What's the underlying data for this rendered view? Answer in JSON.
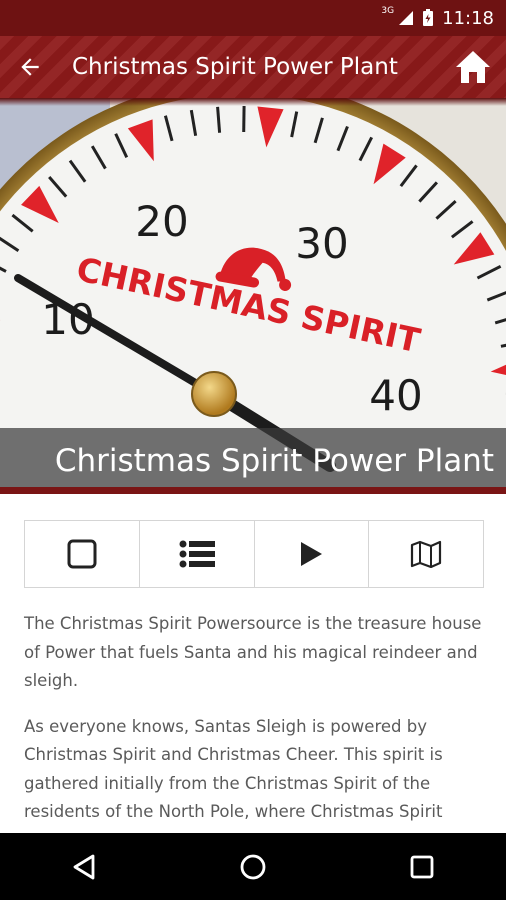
{
  "status_bar": {
    "network": "3G",
    "time": "11:18"
  },
  "app_bar": {
    "title": "Christmas Spirit Power Plant",
    "back_icon": "arrow-left-icon",
    "home_icon": "home-icon"
  },
  "hero": {
    "caption": "Christmas Spirit Power Plant",
    "gauge": {
      "numbers": [
        "10",
        "20",
        "30",
        "40"
      ],
      "label": "CHRISTMAS SPIRIT",
      "needle_value": 8
    }
  },
  "toolbar": {
    "buttons": [
      {
        "icon": "checkbox-icon"
      },
      {
        "icon": "list-icon"
      },
      {
        "icon": "play-icon"
      },
      {
        "icon": "map-icon"
      }
    ]
  },
  "content": {
    "paragraphs": [
      "The Christmas Spirit Powersource is the treasure house of Power that fuels Santa and his magical reindeer and sleigh.",
      "As everyone knows, Santas Sleigh is powered by Christmas Spirit and Christmas Cheer. This spirit is gathered initially from the Christmas Spirit of the residents of the North Pole, where Christmas Spirit"
    ]
  },
  "nav_bar": {
    "buttons": [
      "back-triangle-icon",
      "home-circle-icon",
      "recents-square-icon"
    ]
  },
  "colors": {
    "status_bar": "#6e1212",
    "app_bar": "#8e1a1a",
    "gauge_red": "#e0232a",
    "text": "#5a5a5a"
  }
}
